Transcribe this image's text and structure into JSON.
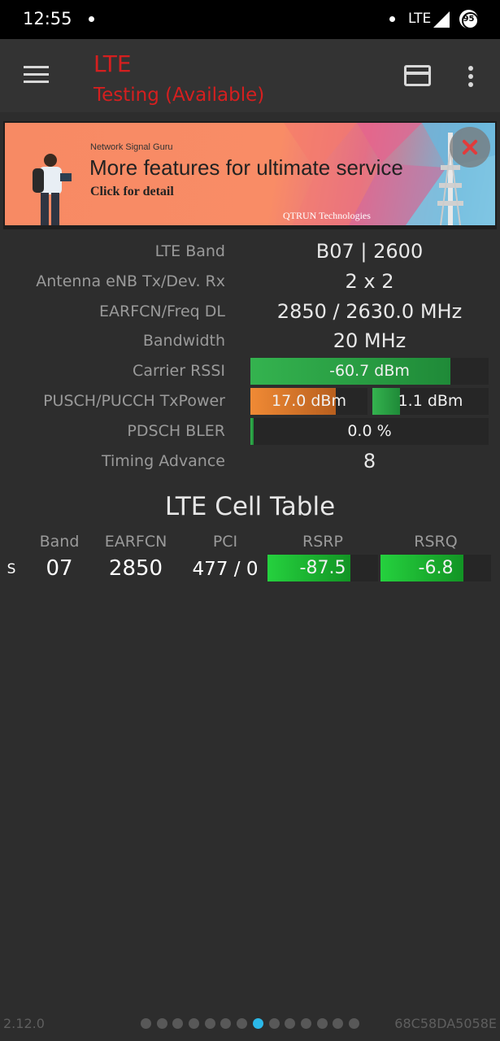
{
  "status_bar": {
    "time": "12:55",
    "network": "LTE",
    "battery": "95"
  },
  "app_bar": {
    "title": "LTE",
    "subtitle": "Testing (Available)"
  },
  "ad": {
    "brand": "Network Signal Guru",
    "headline": "More features for ultimate service",
    "cta": "Click for detail",
    "company": "QTRUN Technologies"
  },
  "info_rows": {
    "lte_band": {
      "label": "LTE Band",
      "value": "B07 | 2600"
    },
    "antenna": {
      "label": "Antenna eNB Tx/Dev. Rx",
      "value": "2 x 2"
    },
    "earfcn": {
      "label": "EARFCN/Freq DL",
      "value": "2850 / 2630.0 MHz"
    },
    "bandwidth": {
      "label": "Bandwidth",
      "value": "20 MHz"
    },
    "carrier_rssi": {
      "label": "Carrier RSSI",
      "value": "-60.7 dBm",
      "level": 0.84
    },
    "txpower": {
      "label": "PUSCH/PUCCH TxPower",
      "pusch": "17.0 dBm",
      "pusch_level": 0.73,
      "pucch": "1.1 dBm",
      "pucch_level": 0.24
    },
    "bler": {
      "label": "PDSCH BLER",
      "value": "0.0 %",
      "level": 0.0
    },
    "timing_advance": {
      "label": "Timing Advance",
      "value": "8"
    }
  },
  "cell_table": {
    "title": "LTE Cell Table",
    "headers": {
      "band": "Band",
      "earfcn": "EARFCN",
      "pci": "PCI",
      "rsrp": "RSRP",
      "rsrq": "RSRQ"
    },
    "rows": [
      {
        "type": "S",
        "band": "07",
        "earfcn": "2850",
        "pci": "477 / 0",
        "rsrp": "-87.5",
        "rsrp_level": 0.75,
        "rsrq": "-6.8",
        "rsrq_level": 0.75
      }
    ]
  },
  "footer": {
    "version": "2.12.0",
    "device_id": "68C58DA5058E",
    "page_count": 14,
    "active_page": 7
  },
  "colors": {
    "title_red": "#d51f1f",
    "bar_green": "#34b34f",
    "bar_orange": "#f08a35",
    "cell_green": "#25d13e",
    "pager_active": "#2bb8e8"
  }
}
